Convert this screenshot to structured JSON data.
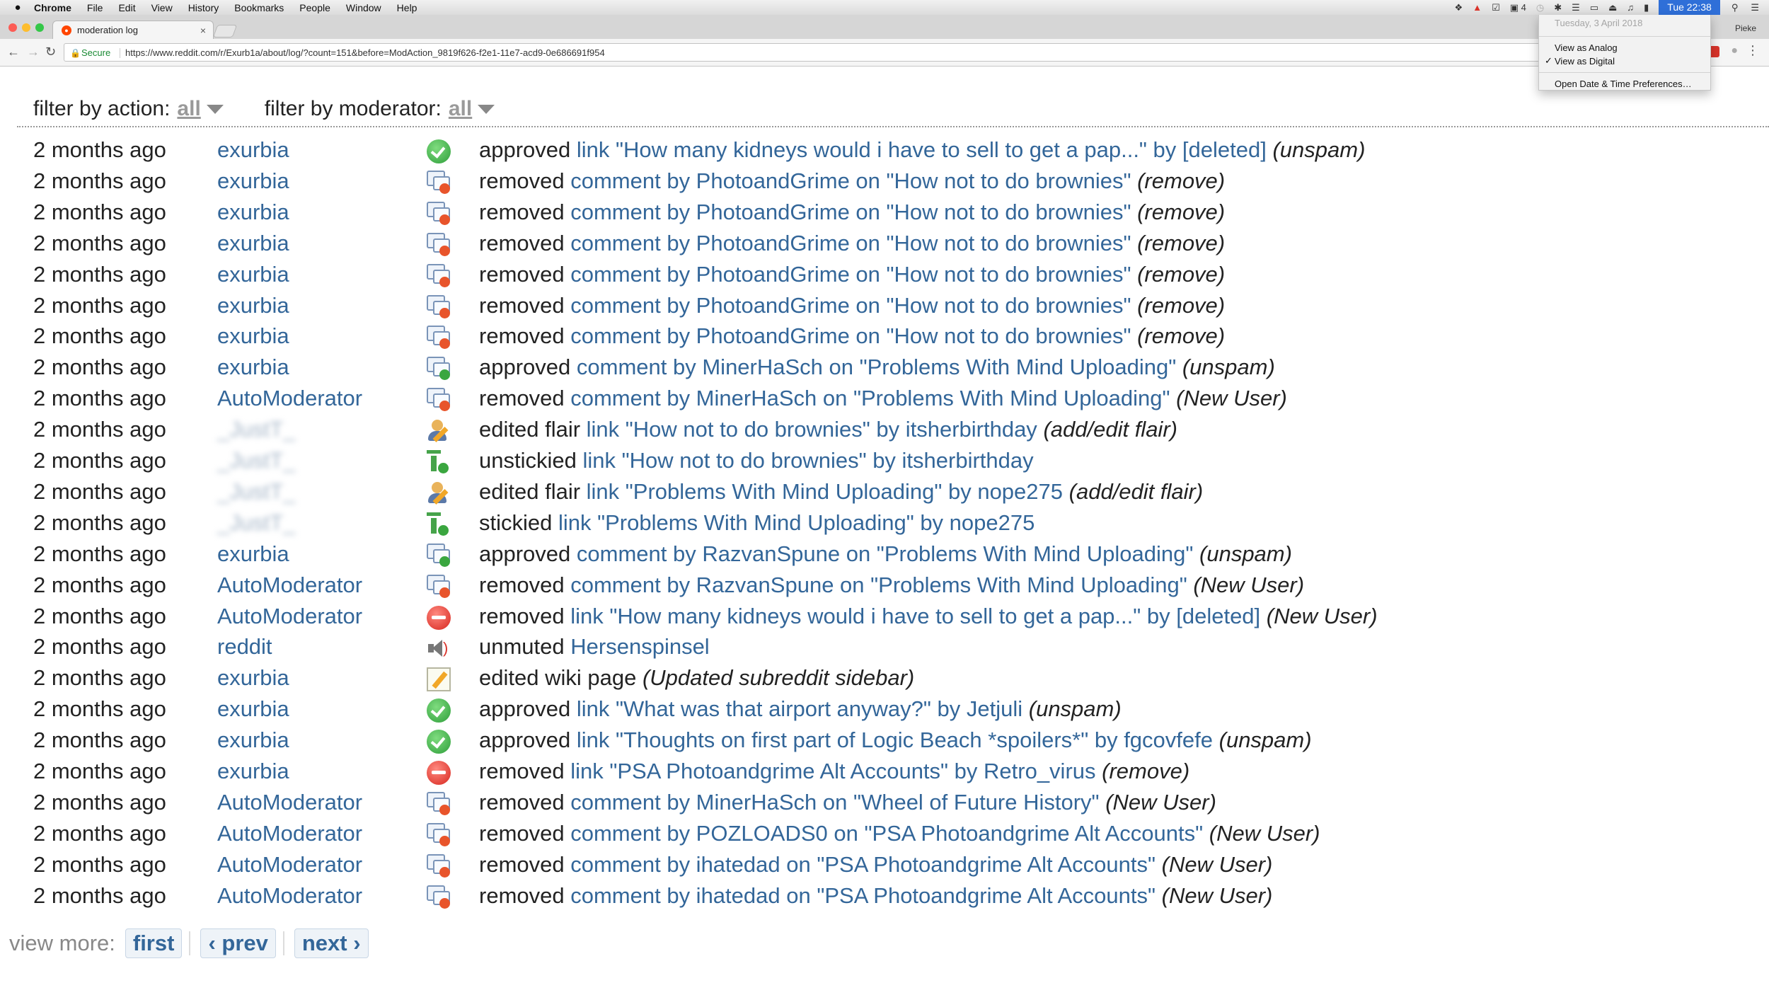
{
  "menubar": {
    "apple": "",
    "items": [
      "Chrome",
      "File",
      "Edit",
      "View",
      "History",
      "Bookmarks",
      "People",
      "Window",
      "Help"
    ],
    "status_badge_count": "4",
    "clock": "Tue 22:38"
  },
  "clock_menu": {
    "date": "Tuesday, 3 April 2018",
    "options": [
      "View as Analog",
      "View as Digital"
    ],
    "checked_index": 1,
    "preferences": "Open Date & Time Preferences…"
  },
  "browser": {
    "tab_title": "moderation log",
    "profile": "Pieke",
    "secure_label": "Secure",
    "url": "https://www.reddit.com/r/Exurb1a/about/log/?count=151&before=ModAction_9819f626-f2e1-11e7-acd9-0e686691f954"
  },
  "filters": {
    "action_label": "filter by action:",
    "action_value": "all",
    "moderator_label": "filter by moderator:",
    "moderator_value": "all"
  },
  "log": [
    {
      "time": "2 months ago",
      "mod": "exurbia",
      "blurred": false,
      "icon": "approve",
      "action": "approved",
      "target": "link \"How many kidneys would i have to sell to get a pap...\" by [deleted]",
      "detail": "(unspam)"
    },
    {
      "time": "2 months ago",
      "mod": "exurbia",
      "blurred": false,
      "icon": "comment-remove",
      "action": "removed",
      "target": "comment by PhotoandGrime on \"How not to do brownies\"",
      "detail": "(remove)"
    },
    {
      "time": "2 months ago",
      "mod": "exurbia",
      "blurred": false,
      "icon": "comment-remove",
      "action": "removed",
      "target": "comment by PhotoandGrime on \"How not to do brownies\"",
      "detail": "(remove)"
    },
    {
      "time": "2 months ago",
      "mod": "exurbia",
      "blurred": false,
      "icon": "comment-remove",
      "action": "removed",
      "target": "comment by PhotoandGrime on \"How not to do brownies\"",
      "detail": "(remove)"
    },
    {
      "time": "2 months ago",
      "mod": "exurbia",
      "blurred": false,
      "icon": "comment-remove",
      "action": "removed",
      "target": "comment by PhotoandGrime on \"How not to do brownies\"",
      "detail": "(remove)"
    },
    {
      "time": "2 months ago",
      "mod": "exurbia",
      "blurred": false,
      "icon": "comment-remove",
      "action": "removed",
      "target": "comment by PhotoandGrime on \"How not to do brownies\"",
      "detail": "(remove)"
    },
    {
      "time": "2 months ago",
      "mod": "exurbia",
      "blurred": false,
      "icon": "comment-remove",
      "action": "removed",
      "target": "comment by PhotoandGrime on \"How not to do brownies\"",
      "detail": "(remove)"
    },
    {
      "time": "2 months ago",
      "mod": "exurbia",
      "blurred": false,
      "icon": "comment-approve",
      "action": "approved",
      "target": "comment by MinerHaSch on \"Problems With Mind Uploading\"",
      "detail": "(unspam)"
    },
    {
      "time": "2 months ago",
      "mod": "AutoModerator",
      "blurred": false,
      "icon": "comment-remove",
      "action": "removed",
      "target": "comment by MinerHaSch on \"Problems With Mind Uploading\"",
      "detail": "(New User)"
    },
    {
      "time": "2 months ago",
      "mod": "_JustT_",
      "blurred": true,
      "icon": "flair",
      "action": "edited flair",
      "target": "link \"How not to do brownies\" by itsherbirthday",
      "detail": "(add/edit flair)"
    },
    {
      "time": "2 months ago",
      "mod": "_JustT_",
      "blurred": true,
      "icon": "sticky",
      "action": "unstickied",
      "target": "link \"How not to do brownies\" by itsherbirthday",
      "detail": ""
    },
    {
      "time": "2 months ago",
      "mod": "_JustT_",
      "blurred": true,
      "icon": "flair",
      "action": "edited flair",
      "target": "link \"Problems With Mind Uploading\" by nope275",
      "detail": "(add/edit flair)"
    },
    {
      "time": "2 months ago",
      "mod": "_JustT_",
      "blurred": true,
      "icon": "sticky",
      "action": "stickied",
      "target": "link \"Problems With Mind Uploading\" by nope275",
      "detail": ""
    },
    {
      "time": "2 months ago",
      "mod": "exurbia",
      "blurred": false,
      "icon": "comment-approve",
      "action": "approved",
      "target": "comment by RazvanSpune on \"Problems With Mind Uploading\"",
      "detail": "(unspam)"
    },
    {
      "time": "2 months ago",
      "mod": "AutoModerator",
      "blurred": false,
      "icon": "comment-remove",
      "action": "removed",
      "target": "comment by RazvanSpune on \"Problems With Mind Uploading\"",
      "detail": "(New User)"
    },
    {
      "time": "2 months ago",
      "mod": "AutoModerator",
      "blurred": false,
      "icon": "remove",
      "action": "removed",
      "target": "link \"How many kidneys would i have to sell to get a pap...\" by [deleted]",
      "detail": "(New User)"
    },
    {
      "time": "2 months ago",
      "mod": "reddit",
      "blurred": false,
      "icon": "mute",
      "action": "unmuted",
      "target": "Hersenspinsel",
      "detail": ""
    },
    {
      "time": "2 months ago",
      "mod": "exurbia",
      "blurred": false,
      "icon": "wiki",
      "action": "edited wiki page",
      "target": "",
      "detail": "(Updated subreddit sidebar)"
    },
    {
      "time": "2 months ago",
      "mod": "exurbia",
      "blurred": false,
      "icon": "approve",
      "action": "approved",
      "target": "link \"What was that airport anyway?\" by Jetjuli",
      "detail": "(unspam)"
    },
    {
      "time": "2 months ago",
      "mod": "exurbia",
      "blurred": false,
      "icon": "approve",
      "action": "approved",
      "target": "link \"Thoughts on first part of Logic Beach *spoilers*\" by fgcovfefe",
      "detail": "(unspam)"
    },
    {
      "time": "2 months ago",
      "mod": "exurbia",
      "blurred": false,
      "icon": "remove",
      "action": "removed",
      "target": "link \"PSA Photoandgrime Alt Accounts\" by Retro_virus",
      "detail": "(remove)"
    },
    {
      "time": "2 months ago",
      "mod": "AutoModerator",
      "blurred": false,
      "icon": "comment-remove",
      "action": "removed",
      "target": "comment by MinerHaSch on \"Wheel of Future History\"",
      "detail": "(New User)"
    },
    {
      "time": "2 months ago",
      "mod": "AutoModerator",
      "blurred": false,
      "icon": "comment-remove",
      "action": "removed",
      "target": "comment by POZLOADS0 on \"PSA Photoandgrime Alt Accounts\"",
      "detail": "(New User)"
    },
    {
      "time": "2 months ago",
      "mod": "AutoModerator",
      "blurred": false,
      "icon": "comment-remove",
      "action": "removed",
      "target": "comment by ihatedad on \"PSA Photoandgrime Alt Accounts\"",
      "detail": "(New User)"
    },
    {
      "time": "2 months ago",
      "mod": "AutoModerator",
      "blurred": false,
      "icon": "comment-remove",
      "action": "removed",
      "target": "comment by ihatedad on \"PSA Photoandgrime Alt Accounts\"",
      "detail": "(New User)"
    }
  ],
  "pager": {
    "label": "view more:",
    "first": "first",
    "prev": "‹ prev",
    "next": "next ›"
  }
}
